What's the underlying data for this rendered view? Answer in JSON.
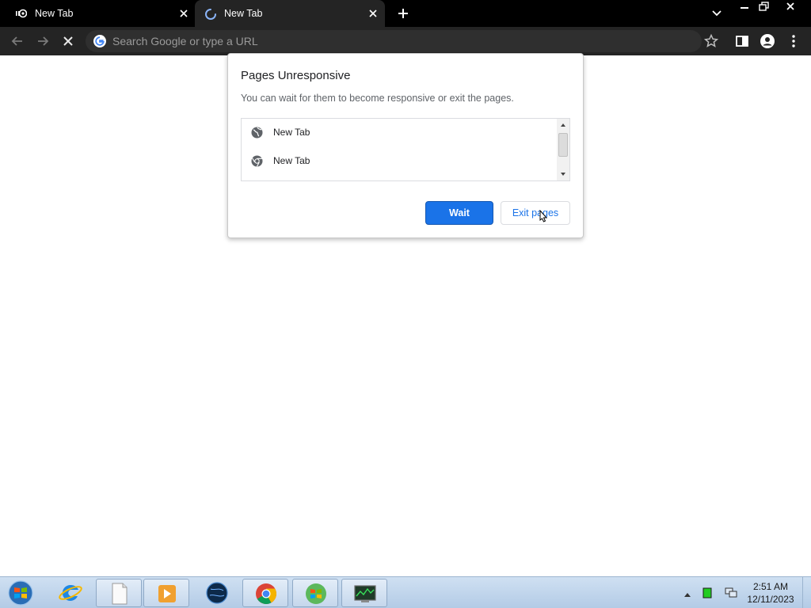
{
  "tabs": [
    {
      "title": "New Tab",
      "state": "inactive",
      "favicon": "chrome-globe-icon"
    },
    {
      "title": "New Tab",
      "state": "active-loading",
      "favicon": "loading-spinner-icon"
    }
  ],
  "omnibox": {
    "placeholder": "Search Google or type a URL"
  },
  "dialog": {
    "title": "Pages Unresponsive",
    "message": "You can wait for them to become responsive or exit the pages.",
    "pages": [
      {
        "label": "New Tab",
        "icon": "globe-icon"
      },
      {
        "label": "New Tab",
        "icon": "chrome-icon"
      }
    ],
    "wait_label": "Wait",
    "exit_label": "Exit pages"
  },
  "taskbar": {
    "apps": [
      "internet-explorer",
      "notepad",
      "media-player",
      "globe-app",
      "chrome",
      "windows-logo-app",
      "task-manager"
    ],
    "clock_time": "2:51 AM",
    "clock_date": "12/11/2023"
  },
  "colors": {
    "accent": "#1a73e8",
    "tabstrip": "#000000",
    "toolbar": "#242424"
  }
}
